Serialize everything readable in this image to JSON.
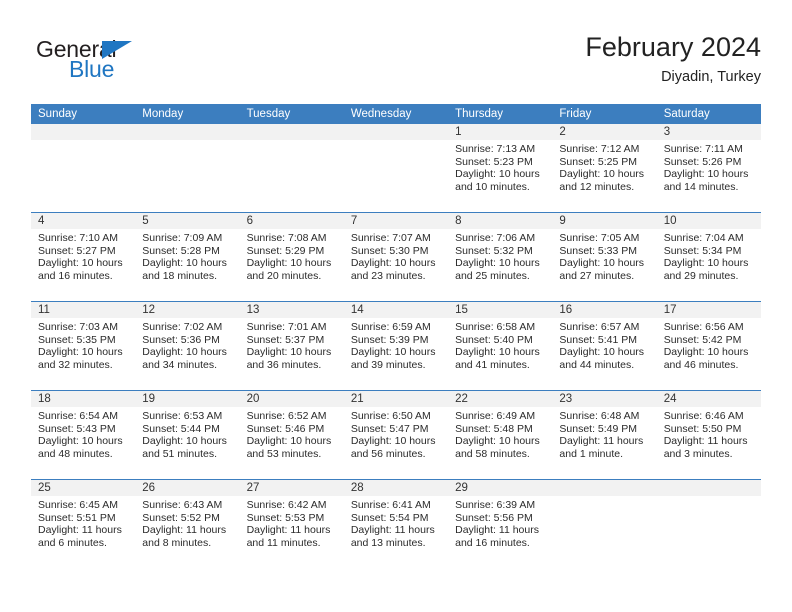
{
  "brand": {
    "name_part1": "General",
    "name_part2": "Blue",
    "flag_color": "#1f76c2",
    "text_color": "#231f20"
  },
  "header": {
    "title": "February 2024",
    "subtitle": "Diyadin, Turkey"
  },
  "theme": {
    "header_blue": "#3c7ebf",
    "row_divider_blue": "#3c7ebf",
    "daynum_band": "#f2f2f2",
    "page_background": "#ffffff"
  },
  "calendar": {
    "weekday_headers": [
      "Sunday",
      "Monday",
      "Tuesday",
      "Wednesday",
      "Thursday",
      "Friday",
      "Saturday"
    ],
    "weeks": [
      [
        {
          "day": "",
          "lines": []
        },
        {
          "day": "",
          "lines": []
        },
        {
          "day": "",
          "lines": []
        },
        {
          "day": "",
          "lines": []
        },
        {
          "day": "1",
          "lines": [
            "Sunrise: 7:13 AM",
            "Sunset: 5:23 PM",
            "Daylight: 10 hours",
            "and 10 minutes."
          ]
        },
        {
          "day": "2",
          "lines": [
            "Sunrise: 7:12 AM",
            "Sunset: 5:25 PM",
            "Daylight: 10 hours",
            "and 12 minutes."
          ]
        },
        {
          "day": "3",
          "lines": [
            "Sunrise: 7:11 AM",
            "Sunset: 5:26 PM",
            "Daylight: 10 hours",
            "and 14 minutes."
          ]
        }
      ],
      [
        {
          "day": "4",
          "lines": [
            "Sunrise: 7:10 AM",
            "Sunset: 5:27 PM",
            "Daylight: 10 hours",
            "and 16 minutes."
          ]
        },
        {
          "day": "5",
          "lines": [
            "Sunrise: 7:09 AM",
            "Sunset: 5:28 PM",
            "Daylight: 10 hours",
            "and 18 minutes."
          ]
        },
        {
          "day": "6",
          "lines": [
            "Sunrise: 7:08 AM",
            "Sunset: 5:29 PM",
            "Daylight: 10 hours",
            "and 20 minutes."
          ]
        },
        {
          "day": "7",
          "lines": [
            "Sunrise: 7:07 AM",
            "Sunset: 5:30 PM",
            "Daylight: 10 hours",
            "and 23 minutes."
          ]
        },
        {
          "day": "8",
          "lines": [
            "Sunrise: 7:06 AM",
            "Sunset: 5:32 PM",
            "Daylight: 10 hours",
            "and 25 minutes."
          ]
        },
        {
          "day": "9",
          "lines": [
            "Sunrise: 7:05 AM",
            "Sunset: 5:33 PM",
            "Daylight: 10 hours",
            "and 27 minutes."
          ]
        },
        {
          "day": "10",
          "lines": [
            "Sunrise: 7:04 AM",
            "Sunset: 5:34 PM",
            "Daylight: 10 hours",
            "and 29 minutes."
          ]
        }
      ],
      [
        {
          "day": "11",
          "lines": [
            "Sunrise: 7:03 AM",
            "Sunset: 5:35 PM",
            "Daylight: 10 hours",
            "and 32 minutes."
          ]
        },
        {
          "day": "12",
          "lines": [
            "Sunrise: 7:02 AM",
            "Sunset: 5:36 PM",
            "Daylight: 10 hours",
            "and 34 minutes."
          ]
        },
        {
          "day": "13",
          "lines": [
            "Sunrise: 7:01 AM",
            "Sunset: 5:37 PM",
            "Daylight: 10 hours",
            "and 36 minutes."
          ]
        },
        {
          "day": "14",
          "lines": [
            "Sunrise: 6:59 AM",
            "Sunset: 5:39 PM",
            "Daylight: 10 hours",
            "and 39 minutes."
          ]
        },
        {
          "day": "15",
          "lines": [
            "Sunrise: 6:58 AM",
            "Sunset: 5:40 PM",
            "Daylight: 10 hours",
            "and 41 minutes."
          ]
        },
        {
          "day": "16",
          "lines": [
            "Sunrise: 6:57 AM",
            "Sunset: 5:41 PM",
            "Daylight: 10 hours",
            "and 44 minutes."
          ]
        },
        {
          "day": "17",
          "lines": [
            "Sunrise: 6:56 AM",
            "Sunset: 5:42 PM",
            "Daylight: 10 hours",
            "and 46 minutes."
          ]
        }
      ],
      [
        {
          "day": "18",
          "lines": [
            "Sunrise: 6:54 AM",
            "Sunset: 5:43 PM",
            "Daylight: 10 hours",
            "and 48 minutes."
          ]
        },
        {
          "day": "19",
          "lines": [
            "Sunrise: 6:53 AM",
            "Sunset: 5:44 PM",
            "Daylight: 10 hours",
            "and 51 minutes."
          ]
        },
        {
          "day": "20",
          "lines": [
            "Sunrise: 6:52 AM",
            "Sunset: 5:46 PM",
            "Daylight: 10 hours",
            "and 53 minutes."
          ]
        },
        {
          "day": "21",
          "lines": [
            "Sunrise: 6:50 AM",
            "Sunset: 5:47 PM",
            "Daylight: 10 hours",
            "and 56 minutes."
          ]
        },
        {
          "day": "22",
          "lines": [
            "Sunrise: 6:49 AM",
            "Sunset: 5:48 PM",
            "Daylight: 10 hours",
            "and 58 minutes."
          ]
        },
        {
          "day": "23",
          "lines": [
            "Sunrise: 6:48 AM",
            "Sunset: 5:49 PM",
            "Daylight: 11 hours",
            "and 1 minute."
          ]
        },
        {
          "day": "24",
          "lines": [
            "Sunrise: 6:46 AM",
            "Sunset: 5:50 PM",
            "Daylight: 11 hours",
            "and 3 minutes."
          ]
        }
      ],
      [
        {
          "day": "25",
          "lines": [
            "Sunrise: 6:45 AM",
            "Sunset: 5:51 PM",
            "Daylight: 11 hours",
            "and 6 minutes."
          ]
        },
        {
          "day": "26",
          "lines": [
            "Sunrise: 6:43 AM",
            "Sunset: 5:52 PM",
            "Daylight: 11 hours",
            "and 8 minutes."
          ]
        },
        {
          "day": "27",
          "lines": [
            "Sunrise: 6:42 AM",
            "Sunset: 5:53 PM",
            "Daylight: 11 hours",
            "and 11 minutes."
          ]
        },
        {
          "day": "28",
          "lines": [
            "Sunrise: 6:41 AM",
            "Sunset: 5:54 PM",
            "Daylight: 11 hours",
            "and 13 minutes."
          ]
        },
        {
          "day": "29",
          "lines": [
            "Sunrise: 6:39 AM",
            "Sunset: 5:56 PM",
            "Daylight: 11 hours",
            "and 16 minutes."
          ]
        },
        {
          "day": "",
          "lines": []
        },
        {
          "day": "",
          "lines": []
        }
      ]
    ]
  }
}
